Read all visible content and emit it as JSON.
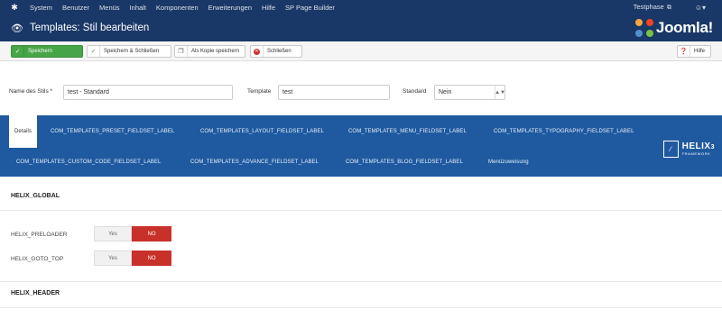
{
  "topnav": {
    "logo_icon": "joomla-mini-icon",
    "items": [
      "System",
      "Benutzer",
      "Menüs",
      "Inhalt",
      "Komponenten",
      "Erweiterungen",
      "Hilfe",
      "SP Page Builder"
    ],
    "site_link": "Testphase",
    "user_icon": "user-icon"
  },
  "header": {
    "title": "Templates: Stil bearbeiten",
    "brand_name": "Joomla!",
    "brand_colors": [
      "#f9a541",
      "#f44321",
      "#5091cd",
      "#7ac143"
    ]
  },
  "toolbar": {
    "save": "Speichern",
    "save_close": "Speichern & Schließen",
    "save_copy": "Als Kopie speichern",
    "close": "Schließen",
    "help": "Hilfe"
  },
  "form": {
    "style_name_label": "Name des Stils *",
    "style_name_value": "test - Standard",
    "template_label": "Template",
    "template_value": "test",
    "default_label": "Standard",
    "default_value": "Nein"
  },
  "tabs": [
    "Details",
    "COM_TEMPLATES_PRESET_FIELDSET_LABEL",
    "COM_TEMPLATES_LAYOUT_FIELDSET_LABEL",
    "COM_TEMPLATES_MENU_FIELDSET_LABEL",
    "COM_TEMPLATES_TYPOGRAPHY_FIELDSET_LABEL",
    "COM_TEMPLATES_CUSTOM_CODE_FIELDSET_LABEL",
    "COM_TEMPLATES_ADVANCE_FIELDSET_LABEL",
    "COM_TEMPLATES_BLOG_FIELDSET_LABEL",
    "Menüzuweisung"
  ],
  "helix": {
    "name": "HELIX",
    "version": "3",
    "tagline": "FRAMEWORK"
  },
  "sections": {
    "global": "HELIX_GLOBAL",
    "header": "HELIX_HEADER"
  },
  "fields": [
    {
      "label": "HELIX_PRELOADER",
      "yes": "Yes",
      "no": "NO",
      "selected": "NO"
    },
    {
      "label": "HELIX_GOTO_TOP",
      "yes": "Yes",
      "no": "NO",
      "selected": "NO"
    }
  ]
}
